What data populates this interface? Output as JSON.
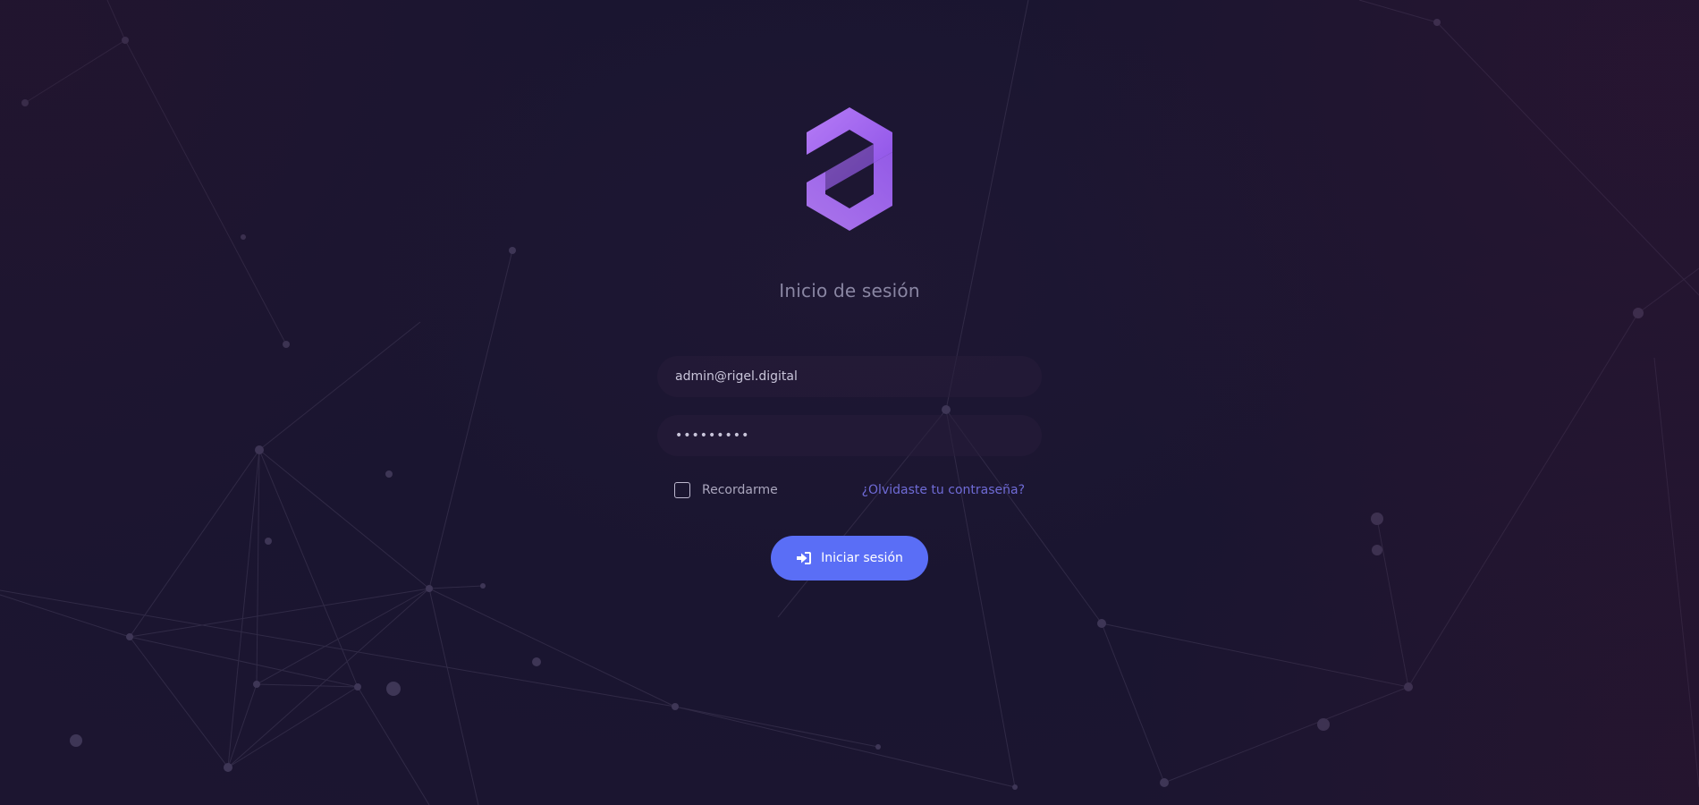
{
  "title": "Inicio de sesión",
  "email": {
    "value": "admin@rigel.digital"
  },
  "password": {
    "value": "•••••••••"
  },
  "remember": {
    "label": "Recordarme",
    "checked": false
  },
  "forgot_link": "¿Olvidaste tu contraseña?",
  "login_button": {
    "label": "Iniciar sesión",
    "color": "#5a6ef6"
  },
  "icons": {
    "logo": "brand-logo-icon",
    "login": "sign-in-icon"
  },
  "colors": {
    "background": "#1b1530",
    "accent": "#5a6ef6",
    "link": "#6f6bd6",
    "logo": "#a065f0"
  }
}
